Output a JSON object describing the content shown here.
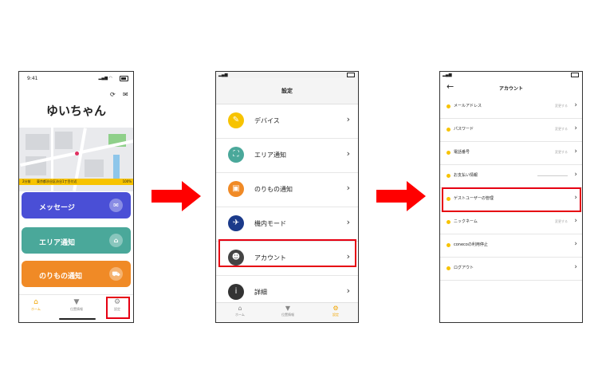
{
  "screen1": {
    "time": "9:41",
    "user_name": "ゆいちゃん",
    "status_label": "2分前",
    "address": "東京都渋谷区渋谷1丁目付近",
    "battery": "100%",
    "buttons": [
      {
        "label": "メッセージ",
        "color": "#4a4fd6"
      },
      {
        "label": "エリア通知",
        "color": "#4aa89a"
      },
      {
        "label": "のりもの通知",
        "color": "#f08a26"
      }
    ],
    "tabs": [
      {
        "label": "ホーム",
        "active": true
      },
      {
        "label": "位置情報",
        "active": false
      },
      {
        "label": "設定",
        "active": false
      }
    ]
  },
  "screen2": {
    "title": "設定",
    "items": [
      {
        "label": "デバイス",
        "icon": "device-icon",
        "color": "#f7c300"
      },
      {
        "label": "エリア通知",
        "icon": "area-icon",
        "color": "#4aa89a"
      },
      {
        "label": "のりもの通知",
        "icon": "vehicle-icon",
        "color": "#f08a26"
      },
      {
        "label": "機内モード",
        "icon": "airplane-icon",
        "color": "#1b3a8a"
      },
      {
        "label": "アカウント",
        "icon": "account-icon",
        "color": "#444444"
      },
      {
        "label": "詳細",
        "icon": "info-icon",
        "color": "#333333"
      }
    ],
    "tabs": [
      {
        "label": "ホーム",
        "active": false
      },
      {
        "label": "位置情報",
        "active": false
      },
      {
        "label": "設定",
        "active": true
      }
    ]
  },
  "screen3": {
    "title": "アカウント",
    "items": [
      {
        "label": "メールアドレス",
        "status": "変更する"
      },
      {
        "label": "パスワード",
        "status": "変更する"
      },
      {
        "label": "電話番号",
        "status": "変更する"
      },
      {
        "label": "お支払い情報",
        "status": ""
      },
      {
        "label": "ゲストユーザーの管理",
        "status": ""
      },
      {
        "label": "ニックネーム",
        "status": "変更する"
      },
      {
        "label": "conecoの利用停止",
        "status": ""
      },
      {
        "label": "ログアウト",
        "status": ""
      }
    ]
  },
  "accent_red": "#e60012",
  "accent_yellow": "#f7c300"
}
